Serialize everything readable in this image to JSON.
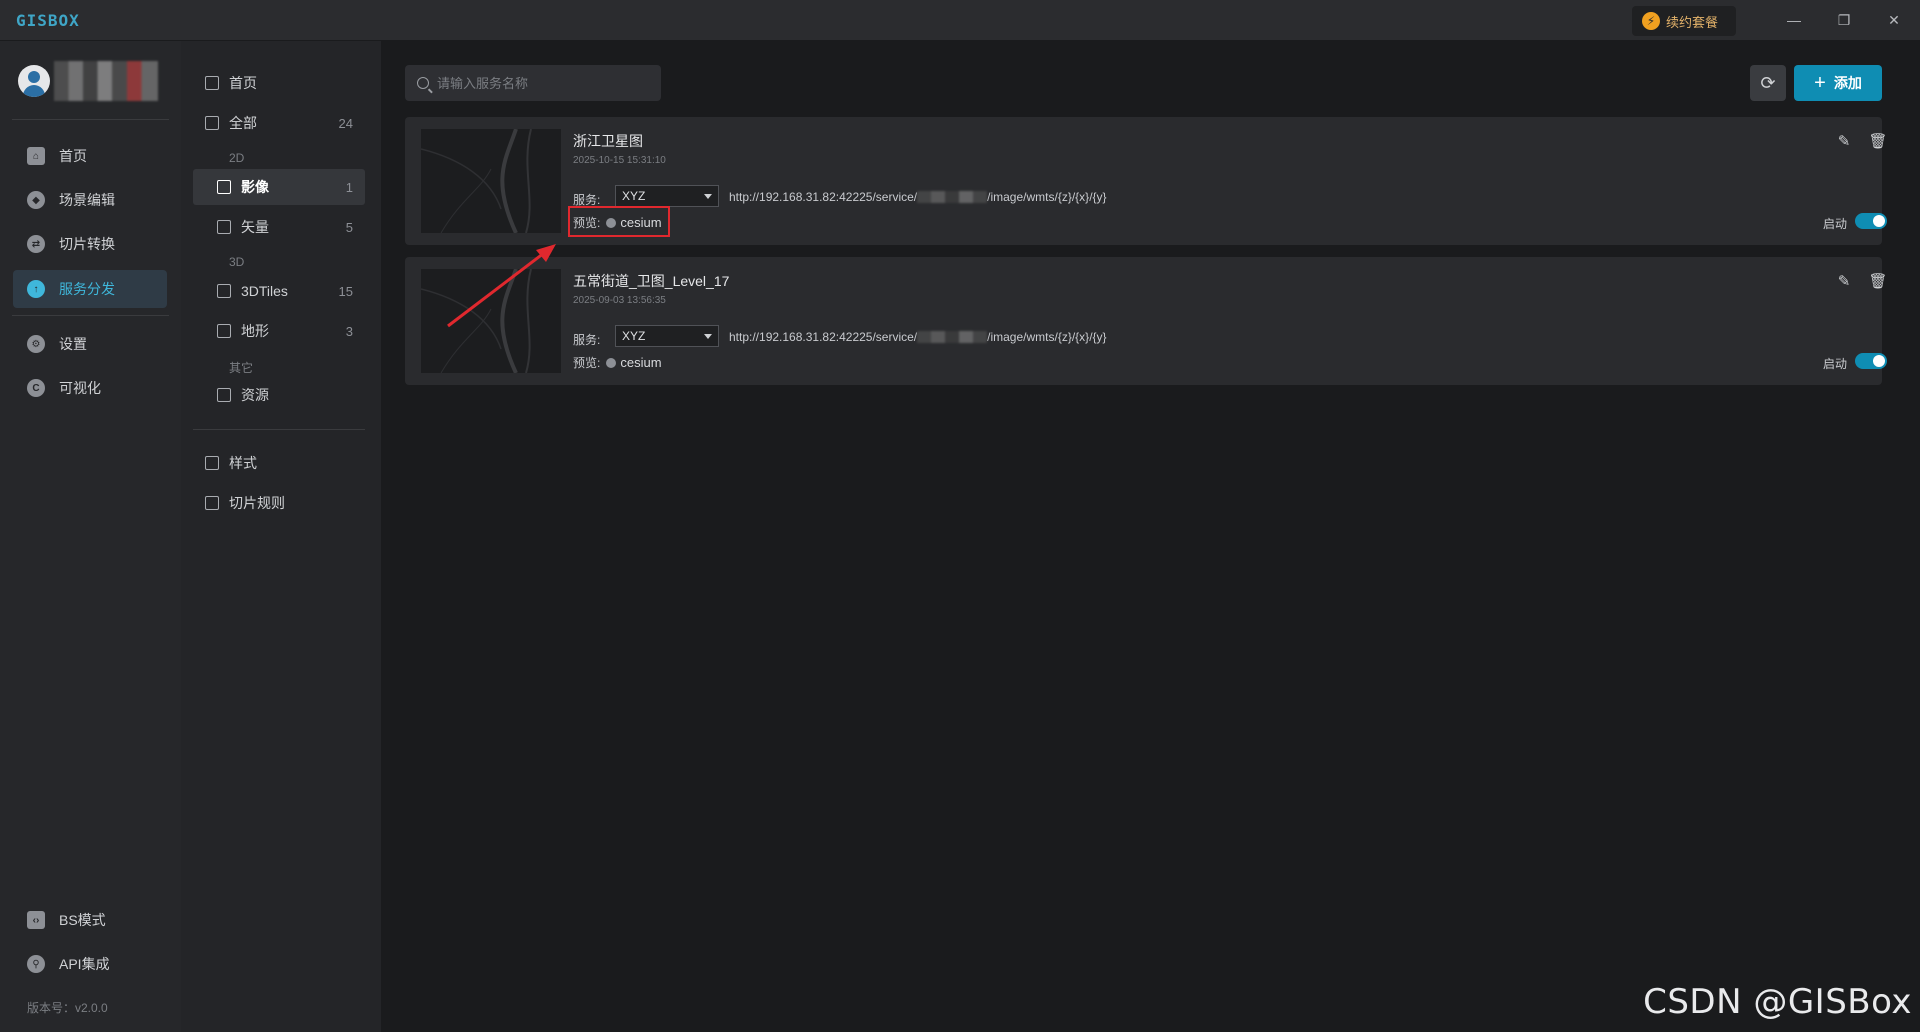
{
  "app": {
    "logo": "GISBOX",
    "renew_label": "续约套餐",
    "version": "版本号：v2.0.0"
  },
  "window_controls": [
    "minimize-icon",
    "restore-icon",
    "close-icon"
  ],
  "leftnav": {
    "items": [
      {
        "label": "首页",
        "icon": "home-icon"
      },
      {
        "label": "场景编辑",
        "icon": "cube-icon"
      },
      {
        "label": "切片转换",
        "icon": "convert-icon"
      },
      {
        "label": "服务分发",
        "icon": "upload-icon",
        "active": true
      },
      {
        "label": "设置",
        "icon": "settings-icon"
      },
      {
        "label": "可视化",
        "icon": "visualize-icon"
      }
    ],
    "bottom_items": [
      {
        "label": "BS模式",
        "icon": "code-icon"
      },
      {
        "label": "API集成",
        "icon": "api-icon"
      }
    ]
  },
  "subnav": {
    "home": "首页",
    "all": {
      "label": "全部",
      "count": "24"
    },
    "group_2d": "2D",
    "imagery": {
      "label": "影像",
      "count": "1"
    },
    "vector": {
      "label": "矢量",
      "count": "5"
    },
    "group_3d": "3D",
    "tiles3d": {
      "label": "3DTiles",
      "count": "15"
    },
    "terrain": {
      "label": "地形",
      "count": "3"
    },
    "group_other": "其它",
    "resource": {
      "label": "资源"
    },
    "style": "样式",
    "tile_rule": "切片规则"
  },
  "main": {
    "search_placeholder": "请输入服务名称",
    "add_label": "添加",
    "cards": [
      {
        "title": "浙江卫星图",
        "date": "2025-10-15 15:31:10",
        "service_label": "服务:",
        "service_type": "XYZ",
        "url_prefix": "http://192.168.31.82:42225/service/",
        "url_suffix": "/image/wmts/{z}/{x}/{y}",
        "preview_label": "预览:",
        "preview_link": "cesium",
        "toggle_label": "启动",
        "enabled": true
      },
      {
        "title": "五常街道_卫图_Level_17",
        "date": "2025-09-03 13:56:35",
        "service_label": "服务:",
        "service_type": "XYZ",
        "url_prefix": "http://192.168.31.82:42225/service/",
        "url_suffix": "/image/wmts/{z}/{x}/{y}",
        "preview_label": "预览:",
        "preview_link": "cesium",
        "toggle_label": "启动",
        "enabled": true
      }
    ]
  },
  "watermark": "CSDN @GISBox",
  "colors": {
    "accent": "#0f8db3",
    "active_nav": "#3fb7db",
    "annotation": "#e0282e"
  }
}
